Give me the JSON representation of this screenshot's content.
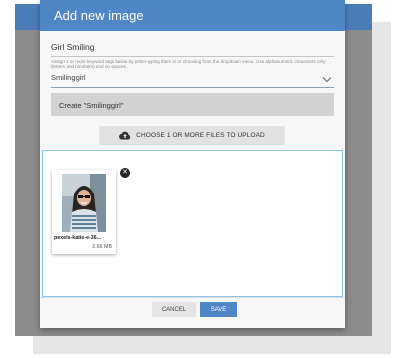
{
  "dialog": {
    "title": "Add new image",
    "name_value": "Girl Smiling",
    "help_text": "Assign 1 or more keyword tags below by either typing them in or choosing from the dropdown menu. Use alphanumeric characters only (letters and numbers) and no spaces.",
    "tag_value": "Smilinggirl",
    "create_option": "Create \"Smilinggirl\"",
    "upload_label": "CHOOSE 1 OR MORE FILES TO UPLOAD",
    "upload_icon": "cloud-upload-icon",
    "files": [
      {
        "name": "pexels-katie-e-36...",
        "size": "2.66 MB"
      }
    ],
    "cancel_label": "CANCEL",
    "save_label": "SAVE"
  },
  "colors": {
    "header": "#4f86c6",
    "save": "#4f86c6",
    "dropzone_border": "#8ec4e6"
  }
}
